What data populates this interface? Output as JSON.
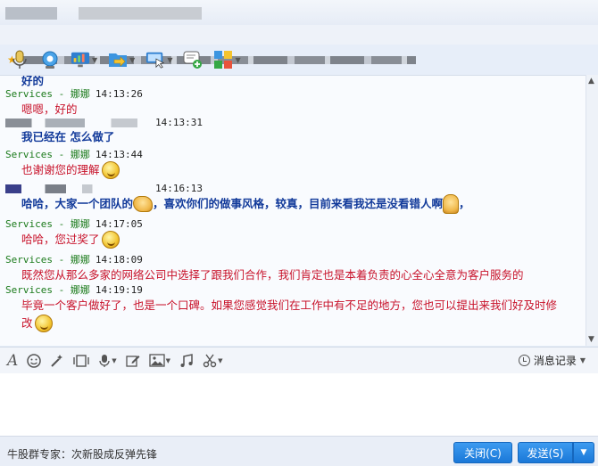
{
  "toolbar": {
    "icons": [
      "mic-icon",
      "camera-icon",
      "screen-share-icon",
      "file-transfer-icon",
      "remote-assist-icon",
      "add-app-icon",
      "apps-grid-icon"
    ]
  },
  "chat": {
    "messages": [
      {
        "kind": "peer-tail",
        "text": "好的"
      },
      {
        "kind": "peer",
        "sender": "Services - 娜娜",
        "time": "14:13:26",
        "text": "嗯嗯，好的"
      },
      {
        "kind": "own",
        "time": "14:13:31",
        "text": "我已经在 怎么做了"
      },
      {
        "kind": "peer",
        "sender": "Services - 娜娜",
        "time": "14:13:44",
        "text": "也谢谢您的理解"
      },
      {
        "kind": "own",
        "time": "14:16:13",
        "text": "哈哈，大家一个团队的",
        "text2": "，喜欢你们的做事风格，较真，目前来看我还是没看错人啊",
        "text3": "，"
      },
      {
        "kind": "peer",
        "sender": "Services - 娜娜",
        "time": "14:17:05",
        "text": "哈哈，您过奖了"
      },
      {
        "kind": "peer",
        "sender": "Services - 娜娜",
        "time": "14:18:09",
        "text": "既然您从那么多家的网络公司中选择了跟我们合作，我们肯定也是本着负责的心全心全意为客户服务的"
      },
      {
        "kind": "peer",
        "sender": "Services - 娜娜",
        "time": "14:19:19",
        "text": "毕竟一个客户做好了，也是一个口碑。如果您感觉我们在工作中有不足的地方，您也可以提出来我们好及时修",
        "text_cont": "改"
      }
    ]
  },
  "input_toolbar": {
    "icons": [
      "font-icon",
      "emoji-icon",
      "magic-icon",
      "screenshot-icon",
      "voice-icon",
      "edit-icon",
      "image-icon",
      "music-icon",
      "scissors-icon"
    ],
    "history_label": "消息记录"
  },
  "footer": {
    "ad_text": "牛股群专家：次新股成反弹先锋",
    "close_label": "关闭(C)",
    "send_label": "发送(S)"
  }
}
